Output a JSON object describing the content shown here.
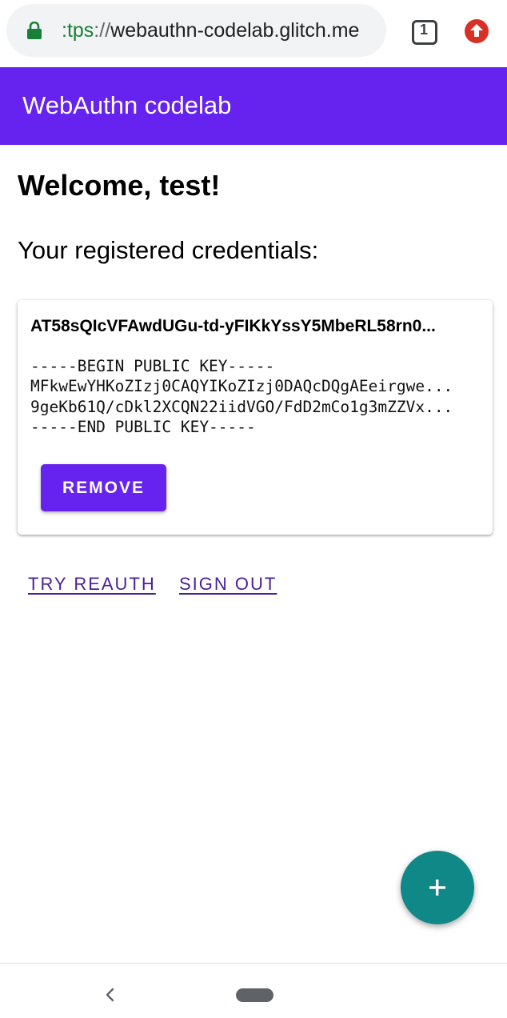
{
  "browser": {
    "url_scheme_visible": ":tps",
    "url_separator": "://",
    "url_host": "webauthn-codelab.glitch.me",
    "tab_count": "1",
    "icons": {
      "lock": "lock-icon",
      "tabs": "tab-switcher-icon",
      "update": "update-available-icon"
    },
    "colors": {
      "lock": "#188038",
      "update": "#d93025"
    }
  },
  "app_bar": {
    "title": "WebAuthn codelab",
    "color": "#6622ee"
  },
  "main": {
    "welcome": "Welcome, test!",
    "credentials_heading": "Your registered credentials:",
    "credentials": [
      {
        "id": "AT58sQIcVFAwdUGu-td-yFIKkYssY5MbeRL58rn0...",
        "public_key_lines": [
          "-----BEGIN PUBLIC KEY-----",
          "MFkwEwYHKoZIzj0CAQYIKoZIzj0DAQcDQgAEeirgwe...",
          "9geKb61Q/cDkl2XCQN22iidVGO/FdD2mCo1g3mZZVx...",
          "-----END PUBLIC KEY-----"
        ],
        "remove_label": "REMOVE"
      }
    ],
    "links": {
      "try_reauth": "TRY REAUTH",
      "sign_out": "SIGN OUT"
    },
    "fab": {
      "icon": "plus-icon",
      "color": "#108888"
    }
  },
  "navbar": {
    "icons": {
      "back": "back-icon",
      "home": "home-pill-icon"
    }
  }
}
